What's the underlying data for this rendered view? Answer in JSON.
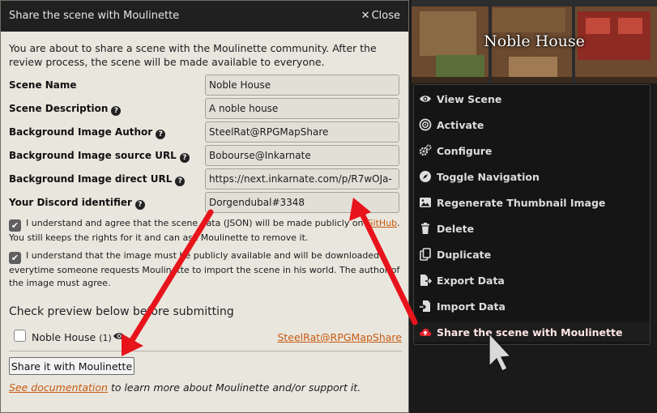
{
  "dialog": {
    "title": "Share the scene with Moulinette",
    "close_label": "Close",
    "intro": "You are about to share a scene with the Moulinette community. After the review process, the scene will be made available to everyone.",
    "fields": [
      {
        "label": "Scene Name",
        "value": "Noble House",
        "help": false
      },
      {
        "label": "Scene Description",
        "value": "A noble house",
        "help": true
      },
      {
        "label": "Background Image Author",
        "value": "SteelRat@RPGMapShare",
        "help": true
      },
      {
        "label": "Background Image source URL",
        "value": "Bobourse@Inkarnate",
        "help": true
      },
      {
        "label": "Background Image direct URL",
        "value": "https://next.inkarnate.com/p/R7wOJa-",
        "help": true
      },
      {
        "label": "Your Discord identifier",
        "value": "Dorgendubal#3348",
        "help": true
      }
    ],
    "consent1_before": "I understand and agree that the scene data (JSON) will be made publicly on ",
    "consent1_link": "GitHub",
    "consent1_after": ". You still keeps the rights for it and can ask Moulinette to remove it.",
    "consent2": "I understand that the image must be publicly available and will be downloaded everytime someone requests Moulinette to import the scene in his world. The author of the image must agree.",
    "preview_title": "Check preview below before submitting",
    "preview_name": "Noble House",
    "preview_count": "(1)",
    "preview_author": "SteelRat@RPGMapShare",
    "submit_label": "Share it with Moulinette",
    "doc_link": "See documentation",
    "doc_text": " to learn more about Moulinette and/or support it."
  },
  "scene": {
    "title": "Noble House"
  },
  "menu": {
    "items": [
      {
        "label": "View Scene",
        "icon": "eye-icon"
      },
      {
        "label": "Activate",
        "icon": "bullseye-icon"
      },
      {
        "label": "Configure",
        "icon": "cogs-icon"
      },
      {
        "label": "Toggle Navigation",
        "icon": "compass-icon"
      },
      {
        "label": "Regenerate Thumbnail Image",
        "icon": "image-icon"
      },
      {
        "label": "Delete",
        "icon": "trash-icon"
      },
      {
        "label": "Duplicate",
        "icon": "copy-icon"
      },
      {
        "label": "Export Data",
        "icon": "file-export-icon"
      },
      {
        "label": "Import Data",
        "icon": "file-import-icon"
      },
      {
        "label": "Share the scene with Moulinette",
        "icon": "cloud-upload-icon"
      }
    ]
  },
  "colors": {
    "link": "#c85a0f",
    "annotation_arrow": "#e8141b",
    "menu_bg": "#151515",
    "dialog_bg": "#e9e6de"
  }
}
